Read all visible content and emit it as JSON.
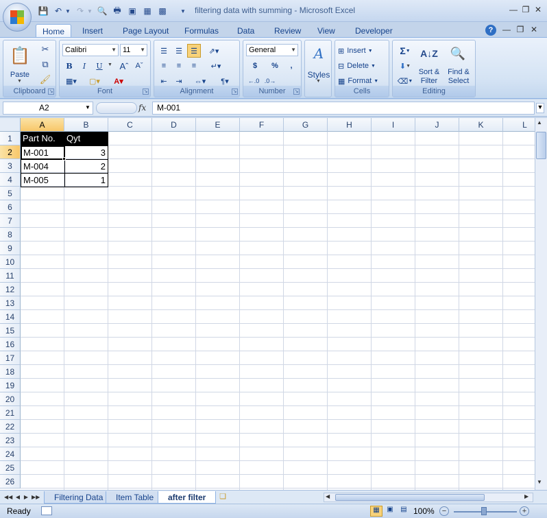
{
  "window": {
    "title": "filtering data with summing - Microsoft Excel"
  },
  "ribbon": {
    "tabs": [
      "Home",
      "Insert",
      "Page Layout",
      "Formulas",
      "Data",
      "Review",
      "View",
      "Developer"
    ],
    "active_tab": "Home",
    "clipboard": {
      "label": "Clipboard",
      "paste": "Paste"
    },
    "font": {
      "label": "Font",
      "name": "Calibri",
      "size": "11",
      "bold": "B",
      "italic": "I",
      "underline": "U"
    },
    "alignment": {
      "label": "Alignment"
    },
    "number": {
      "label": "Number",
      "format": "General",
      "currency": "$",
      "percent": "%",
      "comma": ","
    },
    "styles": {
      "label": "Styles"
    },
    "cells": {
      "label": "Cells",
      "insert": "Insert",
      "delete": "Delete",
      "format": "Format"
    },
    "editing": {
      "label": "Editing",
      "sort_filter_1": "Sort &",
      "sort_filter_2": "Filter",
      "find_select_1": "Find &",
      "find_select_2": "Select"
    }
  },
  "formula_bar": {
    "name_box": "A2",
    "fx": "fx",
    "value": "M-001"
  },
  "grid": {
    "columns": [
      "A",
      "B",
      "C",
      "D",
      "E",
      "F",
      "G",
      "H",
      "I",
      "J",
      "K",
      "L"
    ],
    "rows": [
      "1",
      "2",
      "3",
      "4",
      "5",
      "6",
      "7",
      "8",
      "9",
      "10",
      "11",
      "12",
      "13",
      "14",
      "15",
      "16",
      "17",
      "18",
      "19",
      "20",
      "21",
      "22",
      "23",
      "24",
      "25",
      "26"
    ],
    "data": {
      "header_a": "Part No.",
      "header_b": "Qyt",
      "rows": [
        {
          "a": "M-001",
          "b": "3"
        },
        {
          "a": "M-004",
          "b": "2"
        },
        {
          "a": "M-005",
          "b": "1"
        }
      ]
    }
  },
  "sheets": {
    "tabs": [
      "Filtering Data",
      "Item Table",
      "after filter"
    ],
    "active": "after filter"
  },
  "status": {
    "ready": "Ready",
    "zoom": "100%"
  },
  "colors": {
    "header_fill": "#000000",
    "selection_header": "#f8c769",
    "ribbon_blue": "#15428b"
  }
}
